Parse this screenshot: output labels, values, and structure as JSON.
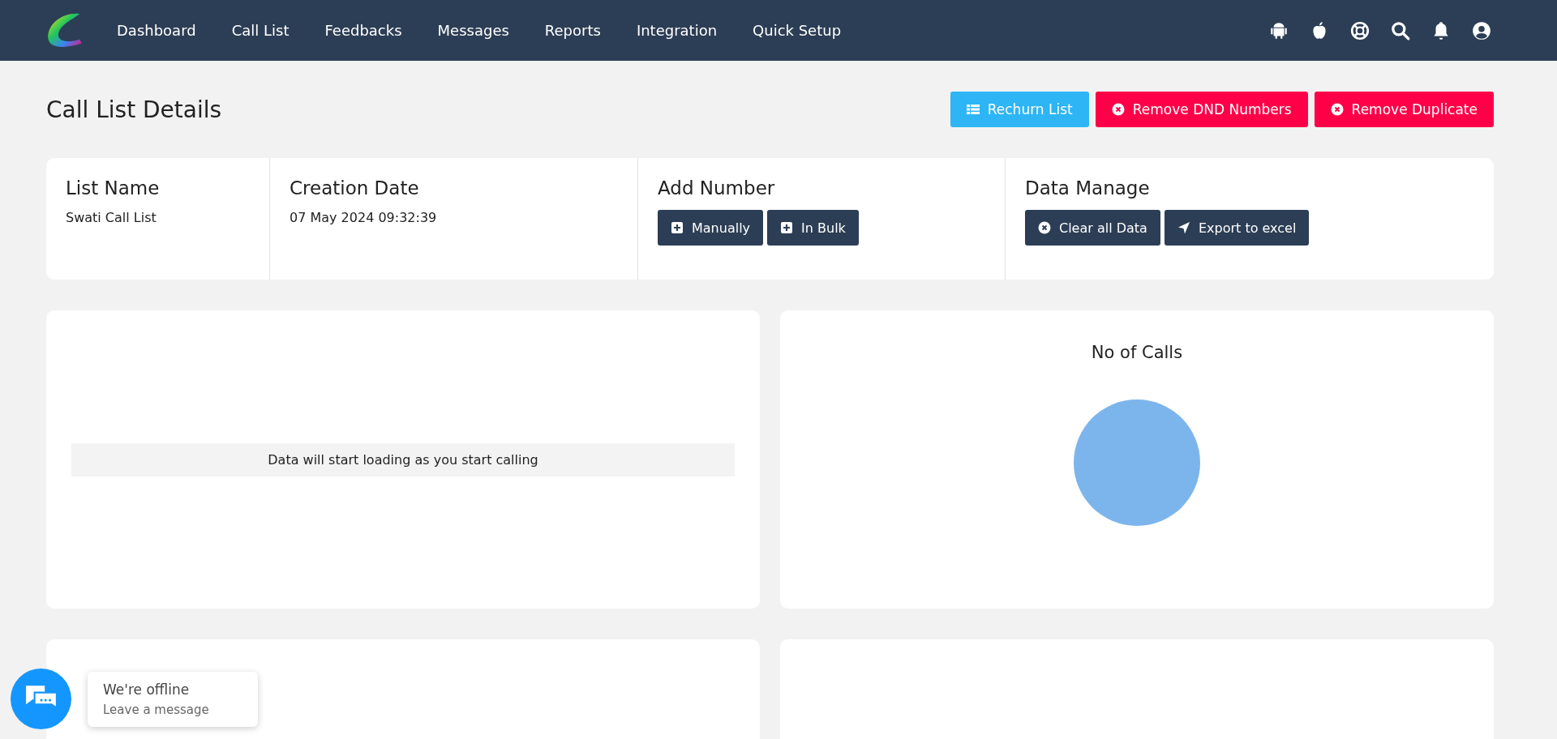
{
  "nav": {
    "items": [
      "Dashboard",
      "Call List",
      "Feedbacks",
      "Messages",
      "Reports",
      "Integration",
      "Quick Setup"
    ]
  },
  "page": {
    "title": "Call List Details",
    "actions": [
      {
        "label": "Rechurn List",
        "kind": "info"
      },
      {
        "label": "Remove DND Numbers",
        "kind": "danger"
      },
      {
        "label": "Remove Duplicate",
        "kind": "danger"
      }
    ]
  },
  "info": [
    {
      "heading": "List Name",
      "value": "Swati Call List"
    },
    {
      "heading": "Creation Date",
      "value": "07 May 2024 09:32:39"
    },
    {
      "heading": "Add Number",
      "buttons": [
        "Manually",
        "In Bulk"
      ]
    },
    {
      "heading": "Data Manage",
      "buttons": [
        "Clear all Data",
        "Export to excel"
      ]
    }
  ],
  "empty_message": "Data will start loading as you start calling",
  "calls_chart": {
    "title": "No of Calls"
  },
  "chat": {
    "title": "We're offline",
    "subtitle": "Leave a message"
  }
}
